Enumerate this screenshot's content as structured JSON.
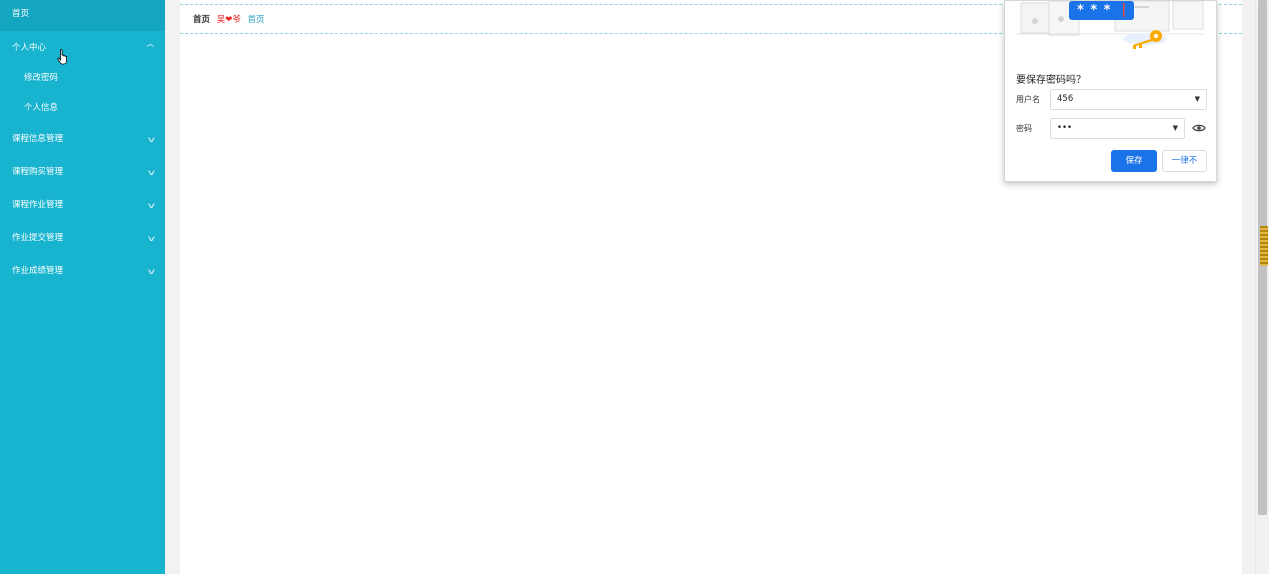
{
  "sidebar": {
    "home_label": "首页",
    "personal_center": {
      "label": "个人中心",
      "expanded": true
    },
    "submenu": [
      {
        "label": "修改密码"
      },
      {
        "label": "个人信息"
      }
    ],
    "items": [
      {
        "label": "课程信息管理"
      },
      {
        "label": "课程购买管理"
      },
      {
        "label": "课程作业管理"
      },
      {
        "label": "作业提交管理"
      },
      {
        "label": "作业成绩管理"
      }
    ],
    "chevron_up": "^",
    "chevron_down": "v",
    "bg_color": "#17b3cf"
  },
  "breadcrumb": {
    "home": "首页",
    "separator": "吴❤爷",
    "current": "首页"
  },
  "password_popup": {
    "title": "要保存密码吗？",
    "username_label": "用户名",
    "username_value": "456",
    "password_label": "密码",
    "password_value": "•••",
    "stars": "* * *",
    "save_label": "保存",
    "never_label": "一律不",
    "accent": "#1a73e8"
  }
}
